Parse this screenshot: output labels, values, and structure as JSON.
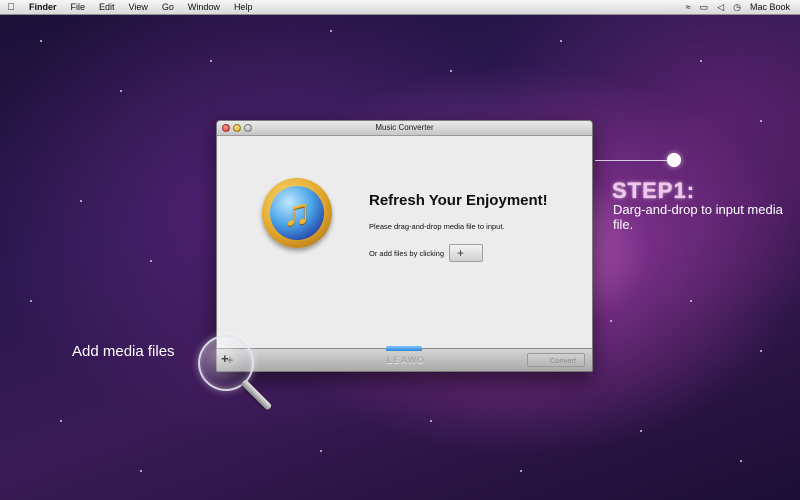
{
  "menubar": {
    "apple_icon": "apple-logo-icon",
    "items": [
      "Finder",
      "File",
      "Edit",
      "View",
      "Go",
      "Window",
      "Help"
    ],
    "user": "Mac Book",
    "status_icons": [
      "wifi-icon",
      "battery-icon",
      "volume-icon",
      "time-machine-icon"
    ]
  },
  "window": {
    "title": "Music Converter",
    "headline": "Refresh Your Enjoyment!",
    "instruction": "Please drag-and-drop media file to input.",
    "add_files_label": "Or add files by clicking",
    "add_button_label": "+",
    "bottom_add_label": "+",
    "brand": "LEAWO",
    "convert_label": "Convert"
  },
  "callouts": {
    "add_media": "Add media files",
    "magnifier_plus": "+",
    "step_title": "STEP1:",
    "step_desc": "Darg-and-drop to input media file."
  }
}
